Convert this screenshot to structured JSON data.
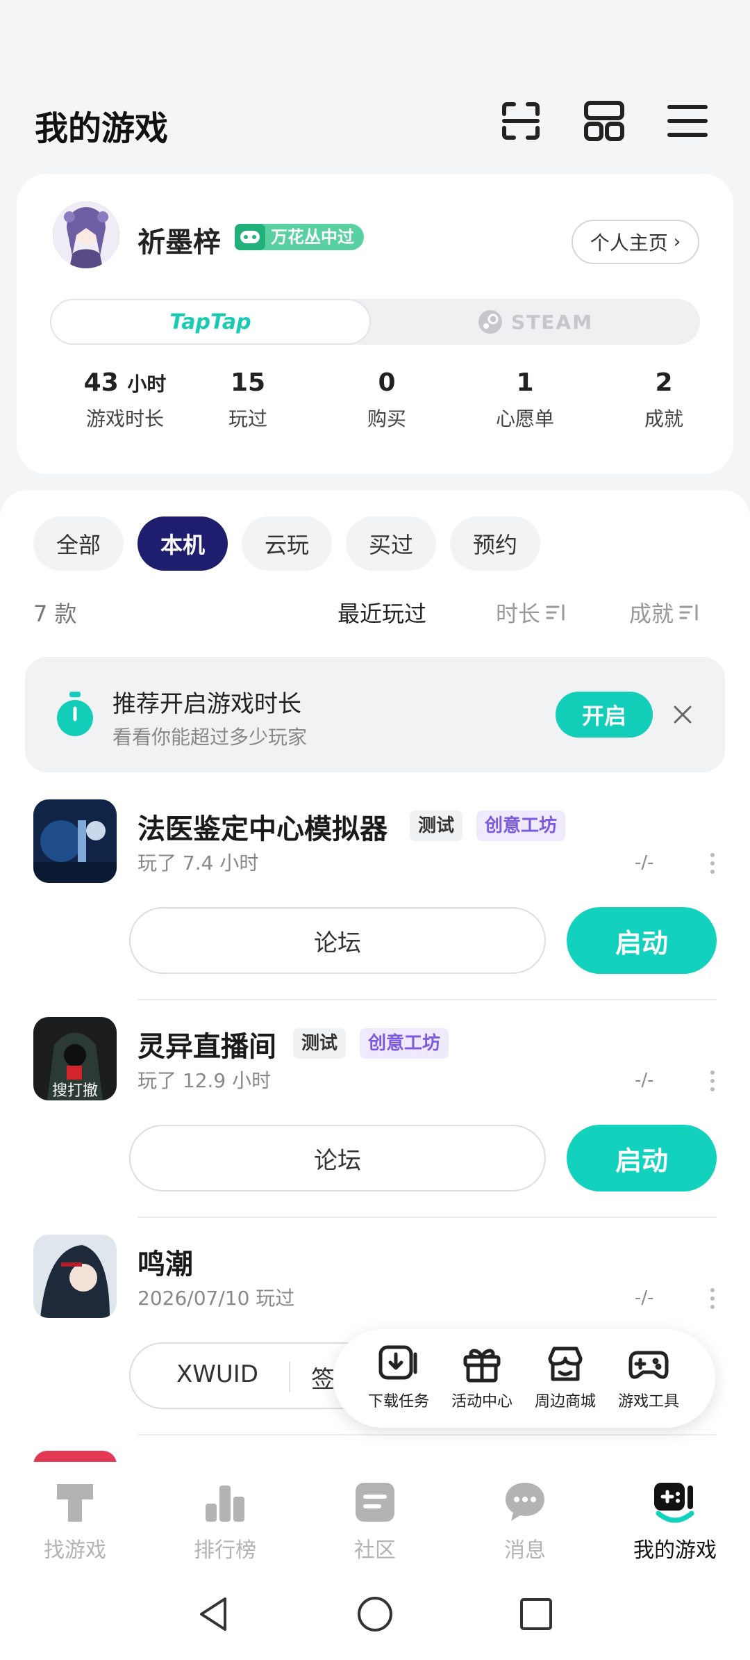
{
  "header": {
    "title": "我的游戏",
    "icons": [
      "scan-icon",
      "grid-icon",
      "menu-icon"
    ]
  },
  "profile": {
    "username": "祈墨梓",
    "badge": "万花丛中过",
    "homepage_label": "个人主页",
    "platforms": {
      "taptap": "TapTap",
      "steam": "STEAM"
    },
    "stats": [
      {
        "value": "43",
        "unit": "小时",
        "label": "游戏时长"
      },
      {
        "value": "15",
        "unit": "",
        "label": "玩过"
      },
      {
        "value": "0",
        "unit": "",
        "label": "购买"
      },
      {
        "value": "1",
        "unit": "",
        "label": "心愿单"
      },
      {
        "value": "2",
        "unit": "",
        "label": "成就"
      }
    ]
  },
  "filters": {
    "chips": [
      "全部",
      "本机",
      "云玩",
      "买过",
      "预约"
    ],
    "active": "本机",
    "count": "7 款",
    "sorts": [
      "最近玩过",
      "时长",
      "成就"
    ]
  },
  "tip": {
    "title": "推荐开启游戏时长",
    "subtitle": "看看你能超过多少玩家",
    "button": "开启"
  },
  "games": [
    {
      "name": "法医鉴定中心模拟器",
      "tags": [
        "测试",
        "创意工坊"
      ],
      "sub": "玩了 7.4 小时",
      "score": "-/-",
      "forum": "论坛",
      "launch": "启动"
    },
    {
      "name": "灵异直播间",
      "tags": [
        "测试",
        "创意工坊"
      ],
      "sub": "玩了 12.9 小时",
      "score": "-/-",
      "forum": "论坛",
      "launch": "启动",
      "icon_caption": "搜打撤"
    },
    {
      "name": "鸣潮",
      "tags": [],
      "sub": "2026/07/10 玩过",
      "score": "-/-",
      "btn1": "XWUID",
      "btn2": "签"
    }
  ],
  "quick_menu": [
    {
      "label": "下载任务",
      "icon": "download-icon"
    },
    {
      "label": "活动中心",
      "icon": "gift-icon"
    },
    {
      "label": "周边商城",
      "icon": "store-icon"
    },
    {
      "label": "游戏工具",
      "icon": "gamepad-icon"
    }
  ],
  "bottom_nav": [
    {
      "label": "找游戏",
      "icon": "discover-icon"
    },
    {
      "label": "排行榜",
      "icon": "ranking-icon"
    },
    {
      "label": "社区",
      "icon": "community-icon"
    },
    {
      "label": "消息",
      "icon": "message-icon"
    },
    {
      "label": "我的游戏",
      "icon": "my-games-icon",
      "active": true
    }
  ],
  "colors": {
    "accent": "#12d1bd",
    "active_chip": "#1f1d6e",
    "badge": "#58d0a2",
    "workshop": "#7b5ae0"
  }
}
